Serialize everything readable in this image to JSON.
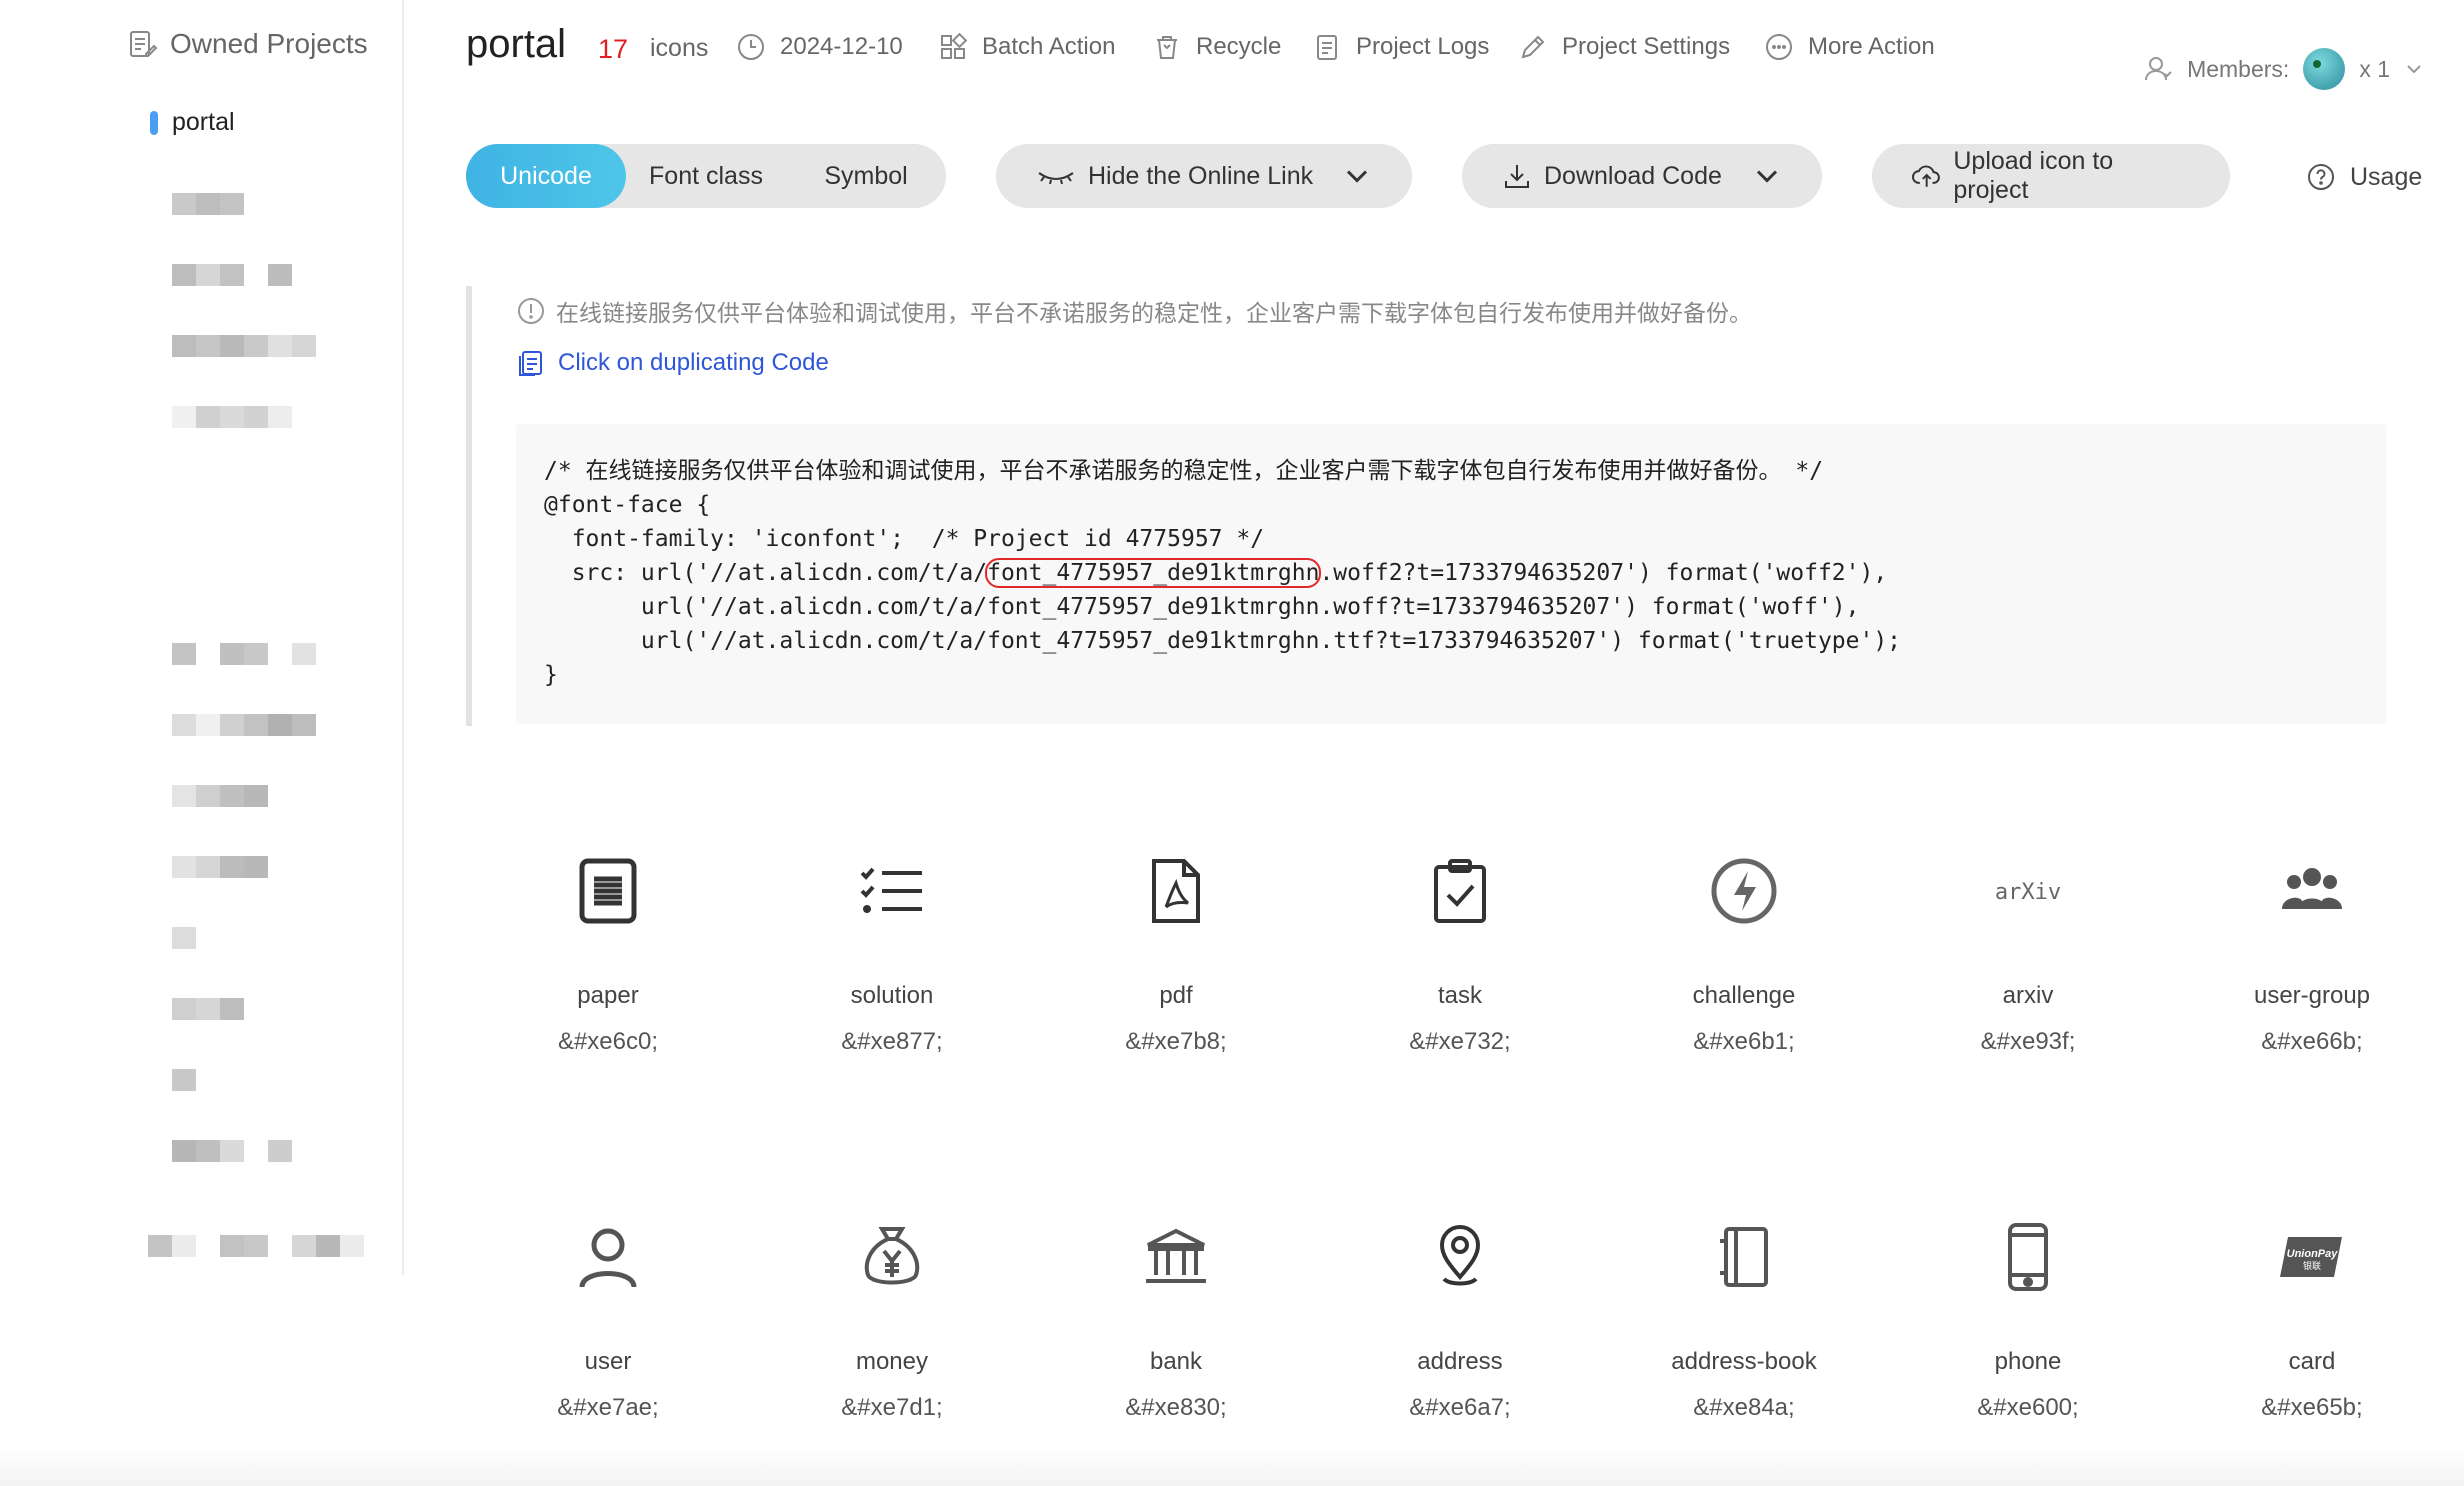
{
  "sidebar": {
    "title": "Owned Projects",
    "active_item": "portal"
  },
  "header": {
    "project_name": "portal",
    "icon_count": "17",
    "icon_count_label": "icons",
    "date": "2024-12-10",
    "batch_action": "Batch Action",
    "recycle": "Recycle",
    "project_logs": "Project Logs",
    "project_settings": "Project Settings",
    "more_action": "More Action",
    "members_label": "Members:",
    "members_count": "x 1"
  },
  "toolbar": {
    "tabs": [
      "Unicode",
      "Font class",
      "Symbol"
    ],
    "active_tab": "Unicode",
    "hide_link": "Hide the Online Link",
    "download_code": "Download Code",
    "upload_icon": "Upload icon to project",
    "usage": "Usage"
  },
  "notice": {
    "warning": "在线链接服务仅供平台体验和调试使用，平台不承诺服务的稳定性，企业客户需下载字体包自行发布使用并做好备份。",
    "copy_link": "Click on duplicating Code"
  },
  "code": {
    "line1": "/* 在线链接服务仅供平台体验和调试使用，平台不承诺服务的稳定性，企业客户需下载字体包自行发布使用并做好备份。 */",
    "line2": "@font-face {",
    "line3": "  font-family: 'iconfont';  /* Project id 4775957 */",
    "line4_pre": "  src: url('//at.alicdn.com/t/a/",
    "line4_hl": "font_4775957_de91ktmrghn",
    "line4_post": ".woff2?t=1733794635207') format('woff2'),",
    "line5": "       url('//at.alicdn.com/t/a/font_4775957_de91ktmrghn.woff?t=1733794635207') format('woff'),",
    "line6": "       url('//at.alicdn.com/t/a/font_4775957_de91ktmrghn.ttf?t=1733794635207') format('truetype');",
    "line7": "}"
  },
  "icons": [
    {
      "name": "paper",
      "code": "&#xe6c0;",
      "icon": "document-icon"
    },
    {
      "name": "solution",
      "code": "&#xe877;",
      "icon": "checklist-icon"
    },
    {
      "name": "pdf",
      "code": "&#xe7b8;",
      "icon": "pdf-icon"
    },
    {
      "name": "task",
      "code": "&#xe732;",
      "icon": "clipboard-check-icon"
    },
    {
      "name": "challenge",
      "code": "&#xe6b1;",
      "icon": "lightning-circle-icon"
    },
    {
      "name": "arxiv",
      "code": "&#xe93f;",
      "icon": "arxiv-logo-icon"
    },
    {
      "name": "user-group",
      "code": "&#xe66b;",
      "icon": "user-group-icon"
    },
    {
      "name": "user",
      "code": "&#xe7ae;",
      "icon": "user-icon"
    },
    {
      "name": "money",
      "code": "&#xe7d1;",
      "icon": "money-bag-icon"
    },
    {
      "name": "bank",
      "code": "&#xe830;",
      "icon": "bank-icon"
    },
    {
      "name": "address",
      "code": "&#xe6a7;",
      "icon": "location-pin-icon"
    },
    {
      "name": "address-book",
      "code": "&#xe84a;",
      "icon": "address-book-icon"
    },
    {
      "name": "phone",
      "code": "&#xe600;",
      "icon": "phone-icon"
    },
    {
      "name": "card",
      "code": "&#xe65b;",
      "icon": "unionpay-card-icon"
    }
  ],
  "icon_logo_text": {
    "arxiv": "arXiv",
    "unionpay": "UnionPay",
    "unionpay_cn": "银联"
  },
  "colors": {
    "accent": "#3fb3e4",
    "count_red": "#e02020",
    "link_blue": "#2f56d8",
    "highlight_red": "#e02a2a"
  }
}
